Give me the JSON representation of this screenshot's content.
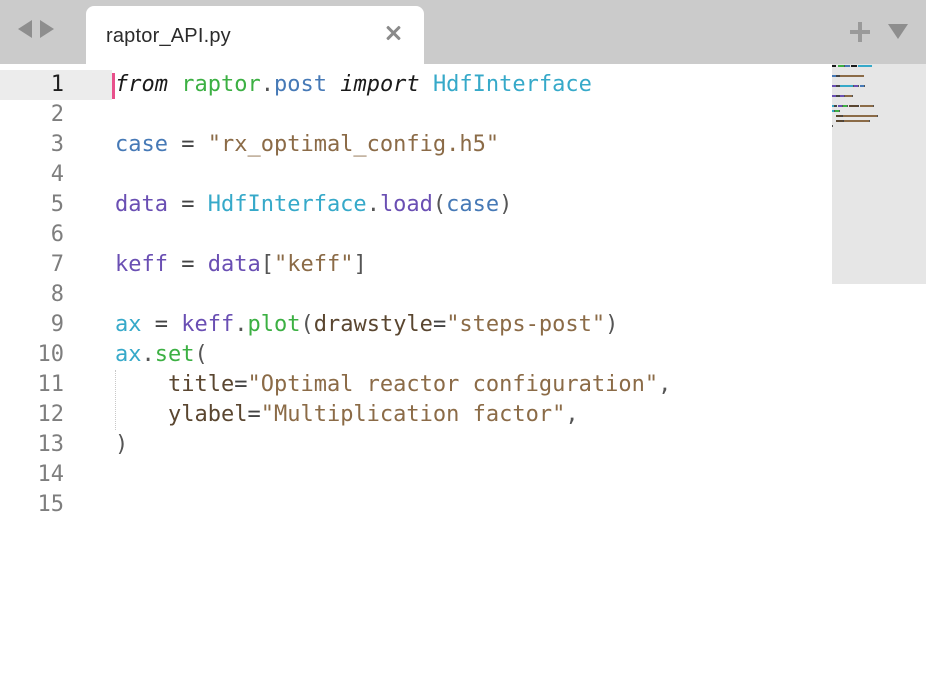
{
  "tab": {
    "title": "raptor_API.py"
  },
  "editor": {
    "current_line": 1,
    "line_numbers": [
      "1",
      "2",
      "3",
      "4",
      "5",
      "6",
      "7",
      "8",
      "9",
      "10",
      "11",
      "12",
      "13",
      "14",
      "15"
    ],
    "code": [
      [
        {
          "t": "from",
          "c": "kw"
        },
        {
          "t": " ",
          "c": "op"
        },
        {
          "t": "raptor",
          "c": "mod"
        },
        {
          "t": ".",
          "c": "punc"
        },
        {
          "t": "post",
          "c": "var"
        },
        {
          "t": " ",
          "c": "op"
        },
        {
          "t": "import",
          "c": "kw"
        },
        {
          "t": " ",
          "c": "op"
        },
        {
          "t": "HdfInterface",
          "c": "cls"
        }
      ],
      [],
      [
        {
          "t": "case",
          "c": "var"
        },
        {
          "t": " = ",
          "c": "op"
        },
        {
          "t": "\"rx_optimal_config.h5\"",
          "c": "str"
        }
      ],
      [],
      [
        {
          "t": "data",
          "c": "attr"
        },
        {
          "t": " = ",
          "c": "op"
        },
        {
          "t": "HdfInterface",
          "c": "cls"
        },
        {
          "t": ".",
          "c": "punc"
        },
        {
          "t": "load",
          "c": "attr"
        },
        {
          "t": "(",
          "c": "punc"
        },
        {
          "t": "case",
          "c": "var"
        },
        {
          "t": ")",
          "c": "punc"
        }
      ],
      [],
      [
        {
          "t": "keff",
          "c": "attr"
        },
        {
          "t": " = ",
          "c": "op"
        },
        {
          "t": "data",
          "c": "attr"
        },
        {
          "t": "[",
          "c": "punc"
        },
        {
          "t": "\"keff\"",
          "c": "str"
        },
        {
          "t": "]",
          "c": "punc"
        }
      ],
      [],
      [
        {
          "t": "ax",
          "c": "cls"
        },
        {
          "t": " = ",
          "c": "op"
        },
        {
          "t": "keff",
          "c": "attr"
        },
        {
          "t": ".",
          "c": "punc"
        },
        {
          "t": "plot",
          "c": "meth"
        },
        {
          "t": "(",
          "c": "punc"
        },
        {
          "t": "drawstyle",
          "c": "param"
        },
        {
          "t": "=",
          "c": "op"
        },
        {
          "t": "\"steps-post\"",
          "c": "str"
        },
        {
          "t": ")",
          "c": "punc"
        }
      ],
      [
        {
          "t": "ax",
          "c": "cls"
        },
        {
          "t": ".",
          "c": "punc"
        },
        {
          "t": "set",
          "c": "meth"
        },
        {
          "t": "(",
          "c": "punc"
        }
      ],
      [
        {
          "t": "    ",
          "c": "op"
        },
        {
          "t": "title",
          "c": "param"
        },
        {
          "t": "=",
          "c": "op"
        },
        {
          "t": "\"Optimal reactor configuration\"",
          "c": "str"
        },
        {
          "t": ",",
          "c": "punc"
        }
      ],
      [
        {
          "t": "    ",
          "c": "op"
        },
        {
          "t": "ylabel",
          "c": "param"
        },
        {
          "t": "=",
          "c": "op"
        },
        {
          "t": "\"Multiplication factor\"",
          "c": "str"
        },
        {
          "t": ",",
          "c": "punc"
        }
      ],
      [
        {
          "t": ")",
          "c": "punc"
        }
      ],
      [],
      []
    ]
  },
  "colors": {
    "caret": "#e8508b",
    "tabbar": "#cbcbcb",
    "minimap": "#e6e6e6"
  }
}
